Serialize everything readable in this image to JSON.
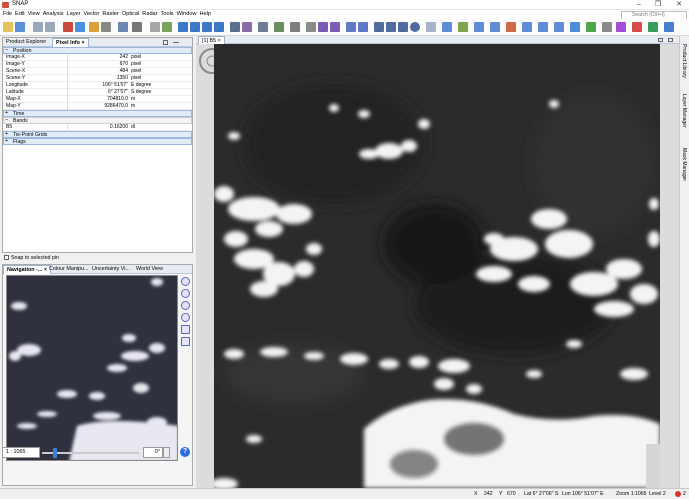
{
  "window": {
    "title": "SNAP",
    "controls": [
      "–",
      "❐",
      "✕"
    ]
  },
  "menu": [
    "File",
    "Edit",
    "View",
    "Analysis",
    "Layer",
    "Vector",
    "Raster",
    "Optical",
    "Radar",
    "Tools",
    "Window",
    "Help"
  ],
  "search": {
    "placeholder": "Search (Ctrl+I)"
  },
  "left_tabs": [
    {
      "label": "Product Explorer",
      "active": false
    },
    {
      "label": "Pixel Info",
      "active": true,
      "close": "×"
    }
  ],
  "pixel_info": {
    "position_title": "Position",
    "position_rows": [
      {
        "key": "Image-X",
        "value": "242",
        "unit": "pixel"
      },
      {
        "key": "Image-Y",
        "value": "670",
        "unit": "pixel"
      },
      {
        "key": "Scene-X",
        "value": "484",
        "unit": "pixel"
      },
      {
        "key": "Scene-Y",
        "value": "1350",
        "unit": "pixel"
      },
      {
        "key": "Longitude",
        "value": "106° 51'07\"",
        "unit": "E degree"
      },
      {
        "key": "Latitude",
        "value": "6° 27'07\"",
        "unit": "S degree"
      },
      {
        "key": "Map-X",
        "value": "704810.0",
        "unit": "m"
      },
      {
        "key": "Map-Y",
        "value": "9286470.0",
        "unit": "m"
      }
    ],
    "time_title": "Time",
    "bands_title": "Bands",
    "band_rows": [
      {
        "key": "B5",
        "value": "0.16200",
        "unit": "dl"
      }
    ],
    "tiepoint_title": "Tie-Point Grids",
    "flags_title": "Flags"
  },
  "snap_pin": {
    "label": "Snap to selected pin"
  },
  "nav_tabs": [
    "Navigation -...",
    "Colour Manipu...",
    "Uncertainty Vi...",
    "World View"
  ],
  "nav_close": "×",
  "navigation": {
    "zoom_value": "1 : 1065",
    "rotation_value": "0°",
    "help": "?"
  },
  "view_tab": {
    "label": "[1] B5",
    "close": "×"
  },
  "right_sidebar": [
    "Product Library",
    "Layer Manager",
    "Mask Manager"
  ],
  "status": {
    "x_label": "X",
    "x_value": "242",
    "y_label": "Y",
    "y_value": "670",
    "lat": "Lat 6° 27'06\" S",
    "lon": "Lon 106° 51'07\" E",
    "zoom": "Zoom 1:1065",
    "level": "Level 2",
    "notifications": "2"
  },
  "colors": {
    "accent": "#2d6cdf",
    "section_bg": "#e2ecf8",
    "notification": "#d93025"
  }
}
